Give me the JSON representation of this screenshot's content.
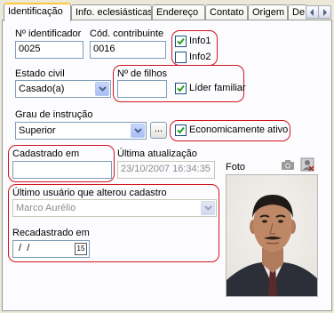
{
  "tabs": {
    "items": [
      "Identificação",
      "Info. eclesiásticas",
      "Endereço",
      "Contato",
      "Origem",
      "De"
    ]
  },
  "form": {
    "identificador": {
      "label": "Nº identificador",
      "value": "0025"
    },
    "contribuinte": {
      "label": "Cód. contribuinte",
      "value": "0016"
    },
    "info1": {
      "label": "Info1",
      "checked": true
    },
    "info2": {
      "label": "Info2",
      "checked": false
    },
    "estado_civil": {
      "label": "Estado civil",
      "value": "Casado(a)"
    },
    "filhos": {
      "label": "Nº de filhos",
      "value": ""
    },
    "lider": {
      "label": "Líder familiar",
      "checked": true
    },
    "grau": {
      "label": "Grau de instrução",
      "value": "Superior",
      "button": "..."
    },
    "economicamente": {
      "label": "Economicamente ativo",
      "checked": true
    },
    "cadastrado": {
      "label": "Cadastrado em",
      "value": ""
    },
    "ultima": {
      "label": "Última atualização",
      "value": "23/10/2007 16:34:35"
    },
    "foto": {
      "label": "Foto"
    },
    "ultimo_usuario": {
      "label": "Último usuário que alterou cadastro",
      "value": "Marco Aurélio"
    },
    "recadastrado": {
      "label": "Recadastrado em",
      "value": " /  /",
      "calendar": "15"
    }
  },
  "colors": {
    "highlight": "#d2141e",
    "tab_accent": "#ffc83c",
    "input_border": "#7f9db9"
  }
}
